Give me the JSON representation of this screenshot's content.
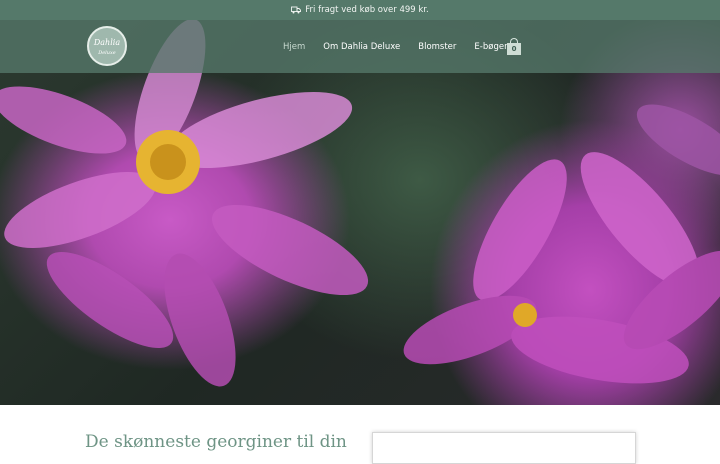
{
  "announcement": {
    "text": "Fri fragt ved køb over 499 kr."
  },
  "logo": {
    "text_line1": "Dahlia",
    "text_line2": "Deluxe"
  },
  "nav": {
    "items": [
      {
        "label": "Hjem",
        "active": true
      },
      {
        "label": "Om Dahlia Deluxe",
        "active": false
      },
      {
        "label": "Blomster",
        "active": false
      },
      {
        "label": "E-bøger",
        "active": false
      }
    ]
  },
  "cart": {
    "count": "0"
  },
  "main": {
    "headline": "De skønneste georginer til din"
  },
  "colors": {
    "brand": "#55796a",
    "headline": "#6e9485",
    "flower": "#c350c0"
  }
}
